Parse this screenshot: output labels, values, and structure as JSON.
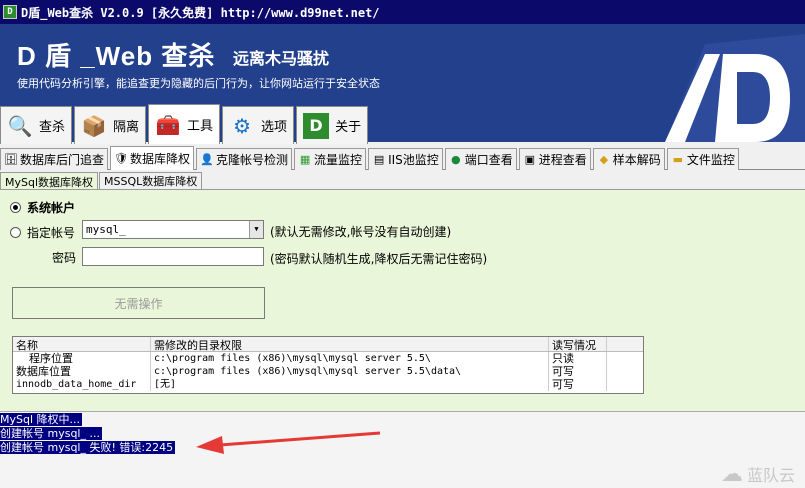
{
  "window": {
    "title": "D盾_Web查杀 V2.0.9 [永久免费] http://www.d99net.net/"
  },
  "banner": {
    "title": "D 盾 _Web 查杀",
    "slogan": "远离木马骚扰",
    "desc": "使用代码分析引擎，能追查更为隐藏的后门行为，让你网站运行于安全状态"
  },
  "main_tabs": [
    {
      "label": "查杀",
      "icon": "magnifier-icon"
    },
    {
      "label": "隔离",
      "icon": "box-icon"
    },
    {
      "label": "工具",
      "icon": "toolbox-icon"
    },
    {
      "label": "选项",
      "icon": "gear-icon"
    },
    {
      "label": "关于",
      "icon": "d-logo-icon"
    }
  ],
  "sub_tabs": [
    {
      "label": "数据库后门追查",
      "icon": "database-search-icon"
    },
    {
      "label": "数据库降权",
      "icon": "shield-check-icon"
    },
    {
      "label": "克隆帐号检测",
      "icon": "user-clone-icon"
    },
    {
      "label": "流量监控",
      "icon": "chart-icon"
    },
    {
      "label": "IIS池监控",
      "icon": "server-icon"
    },
    {
      "label": "端口查看",
      "icon": "globe-icon"
    },
    {
      "label": "进程查看",
      "icon": "process-icon"
    },
    {
      "label": "样本解码",
      "icon": "tag-icon"
    },
    {
      "label": "文件监控",
      "icon": "folder-icon"
    }
  ],
  "inner_tabs": [
    {
      "label": "MySql数据库降权"
    },
    {
      "label": "MSSQL数据库降权"
    }
  ],
  "form": {
    "radio_system": "系统帐户",
    "radio_specify": "指定帐号",
    "account_value": "mysql_",
    "account_hint": "(默认无需修改,帐号没有自动创建)",
    "password_label": "密码",
    "password_hint": "(密码默认随机生成,降权后无需记住密码)",
    "action_button": "无需操作"
  },
  "table": {
    "headers": [
      "名称",
      "需修改的目录权限",
      "读写情况"
    ],
    "rows": [
      [
        "程序位置",
        "c:\\program files (x86)\\mysql\\mysql server 5.5\\",
        "只读"
      ],
      [
        "数据库位置",
        "c:\\program files (x86)\\mysql\\mysql server 5.5\\data\\",
        "可写"
      ],
      [
        "innodb_data_home_dir",
        "[无]",
        "可写"
      ]
    ]
  },
  "log": [
    "MySql 降权中...",
    "创建帐号 mysql_ ...",
    "创建帐号 mysql_ 失败! 错误:2245"
  ],
  "watermark": "蓝队云",
  "colors": {
    "banner": "#23408c",
    "panel": "#eaf6d9",
    "selection": "#000080",
    "arrow": "#e53935"
  }
}
